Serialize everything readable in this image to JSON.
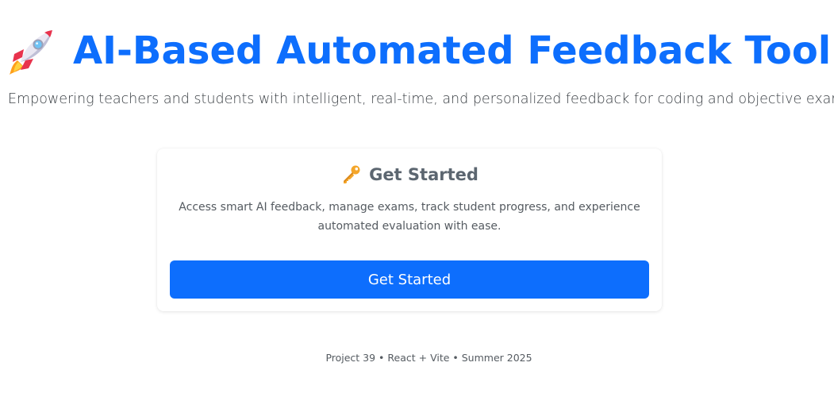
{
  "header": {
    "icon": "rocket-icon",
    "title": "AI-Based Automated Feedback Tool",
    "subtitle": "Empowering teachers and students with intelligent, real-time, and personalized feedback for coding and objective exams."
  },
  "card": {
    "icon": "key-icon",
    "title": "Get Started",
    "description": "Access smart AI feedback, manage exams, track student progress, and experience automated evaluation with ease.",
    "button_label": "Get Started"
  },
  "footer": {
    "text": "Project 39 • React + Vite • Summer 2025"
  },
  "colors": {
    "accent": "#0d6efd",
    "background": "#ffffff",
    "muted_text": "#555b61",
    "card_title": "#5c6670"
  }
}
